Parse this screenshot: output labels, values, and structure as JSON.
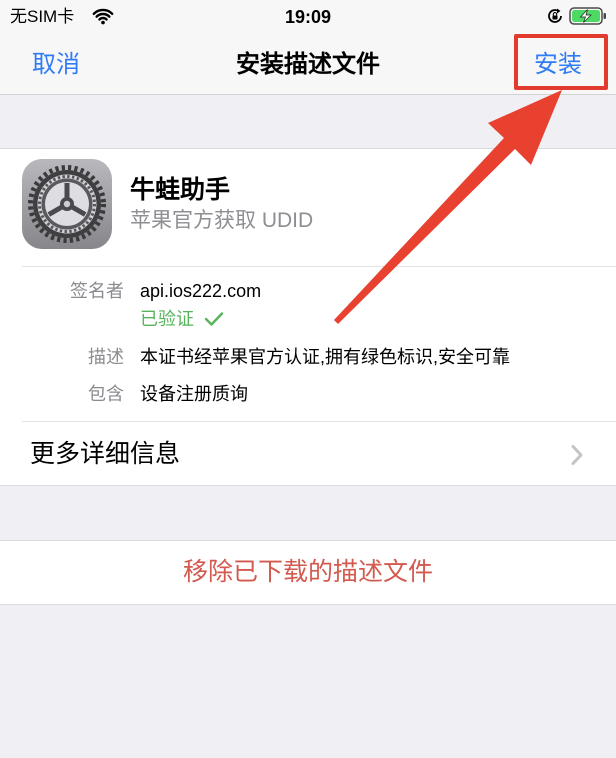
{
  "status_bar": {
    "carrier": "无SIM卡",
    "time": "19:09"
  },
  "nav": {
    "cancel_label": "取消",
    "title": "安装描述文件",
    "install_label": "安装"
  },
  "profile": {
    "name": "牛蛙助手",
    "subtitle": "苹果官方获取 UDID",
    "details": [
      {
        "label": "签名者",
        "value": "api.ios222.com"
      },
      {
        "label": "描述",
        "value": "本证书经苹果官方认证,拥有绿色标识,安全可靠"
      },
      {
        "label": "包含",
        "value": "设备注册质询"
      }
    ],
    "verified_label": "已验证"
  },
  "more_details_label": "更多详细信息",
  "remove_label": "移除已下载的描述文件",
  "icons": {
    "profile_icon": "settings-gear-icon",
    "wifi": "wifi-icon",
    "rotation_lock": "rotation-lock-icon",
    "battery": "battery-charging-icon",
    "verified": "checkmark-icon",
    "more_details": "chevron-right-icon"
  },
  "colors": {
    "accent": "#2f7bf6",
    "destructive": "#d25a4f",
    "verified": "#58b45c",
    "battery": "#4cd964",
    "annotation": "#e23b2e",
    "background": "#efeff4"
  }
}
